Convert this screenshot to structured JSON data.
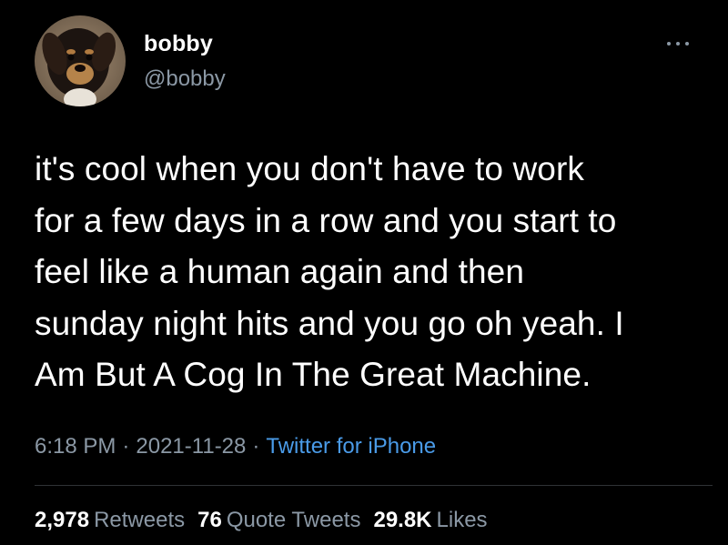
{
  "author": {
    "display_name": "bobby",
    "handle": "@bobby",
    "avatar_icon": "dog-avatar"
  },
  "menu": {
    "icon": "more-icon"
  },
  "tweet": {
    "text": "it's cool when you don't have to work\nfor a few days in a row and you start to\nfeel like a human again and then\nsunday night hits and you go oh yeah. I\nAm But A Cog In The Great Machine."
  },
  "meta": {
    "time": "6:18 PM",
    "separator": "·",
    "date": "2021-11-28",
    "source": "Twitter for iPhone"
  },
  "stats": {
    "retweets_count": "2,978",
    "retweets_label": "Retweets",
    "quotes_count": "76",
    "quotes_label": "Quote Tweets",
    "likes_count": "29.8K",
    "likes_label": "Likes"
  },
  "colors": {
    "background": "#000000",
    "primary_text": "#ffffff",
    "secondary_text": "#8b98a5",
    "link": "#4a9be8",
    "divider": "#2f3336"
  }
}
